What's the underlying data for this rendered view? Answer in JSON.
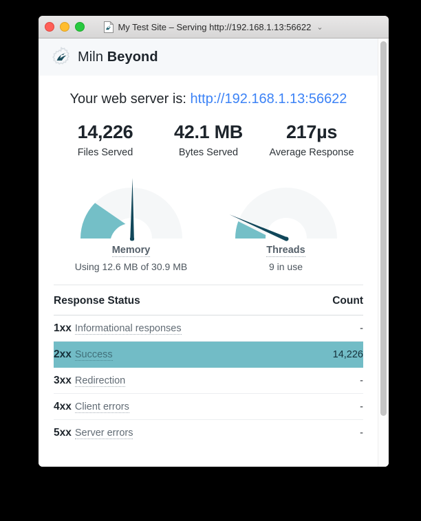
{
  "window": {
    "title": "My Test Site – Serving http://192.168.1.13:56622",
    "title_chevron": "⌄",
    "doc_icon": "document-with-bird-icon",
    "traffic_lights": [
      {
        "name": "close",
        "color": "#ff5f57"
      },
      {
        "name": "minimize",
        "color": "#ffbd2e"
      },
      {
        "name": "zoom",
        "color": "#28c940"
      }
    ]
  },
  "brand": {
    "logo_icon": "gear-with-bird-logo",
    "name_light": "Miln ",
    "name_bold": "Beyond"
  },
  "server": {
    "prefix": "Your web server is:",
    "url_text": "http://192.168.1.13:56622",
    "url_color": "#3b82f6"
  },
  "stats": [
    {
      "value": "14,226",
      "label": "Files Served"
    },
    {
      "value": "42.1 MB",
      "label": "Bytes Served"
    },
    {
      "value": "217µs",
      "label": "Average Response"
    }
  ],
  "gauges": [
    {
      "title": "Memory",
      "subtitle": "Using 12.6 MB of 30.9 MB",
      "used_mb": 12.6,
      "total_mb": 30.9,
      "fraction": 0.408,
      "fill_color": "#74bfc7",
      "track_color": "#f5f7f8",
      "needle_color": "#11475a"
    },
    {
      "title": "Threads",
      "subtitle": "9 in use",
      "in_use": 9,
      "fraction": 0.11,
      "fill_color": "#74bfc7",
      "track_color": "#f5f7f8",
      "needle_color": "#11475a"
    }
  ],
  "table": {
    "header_status": "Response Status",
    "header_count": "Count",
    "highlight_color": "#72bcc6",
    "rows": [
      {
        "code": "1xx",
        "desc": "Informational responses",
        "count": "-",
        "highlight": false
      },
      {
        "code": "2xx",
        "desc": "Success",
        "count": "14,226",
        "highlight": true
      },
      {
        "code": "3xx",
        "desc": "Redirection",
        "count": "-",
        "highlight": false
      },
      {
        "code": "4xx",
        "desc": "Client errors",
        "count": "-",
        "highlight": false
      },
      {
        "code": "5xx",
        "desc": "Server errors",
        "count": "-",
        "highlight": false
      }
    ]
  },
  "scrollbar": {
    "name": "vertical-scrollbar",
    "thumb_color": "#c4c4c4"
  }
}
